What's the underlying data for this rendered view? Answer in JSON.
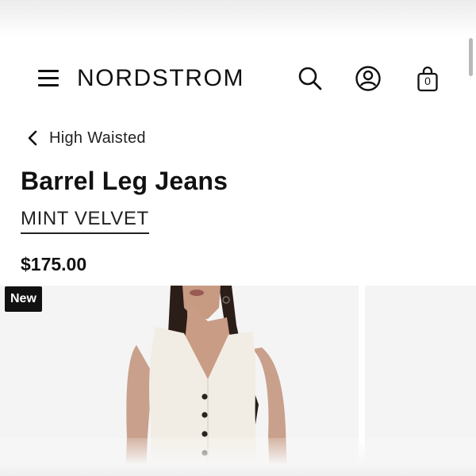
{
  "header": {
    "logo": "NORDSTROM",
    "bag_count": "0"
  },
  "breadcrumb": {
    "label": "High Waisted"
  },
  "product": {
    "title": "Barrel Leg Jeans",
    "brand": "MINT VELVET",
    "price": "$175.00",
    "badge": "New"
  },
  "icons": {
    "menu": "hamburger-menu-icon",
    "search": "search-icon",
    "account": "account-icon",
    "bag": "shopping-bag-icon",
    "back": "chevron-left-icon"
  },
  "colors": {
    "text": "#111111",
    "badge_bg": "#111111",
    "badge_text": "#ffffff",
    "photo_bg": "#f4f4f4"
  }
}
